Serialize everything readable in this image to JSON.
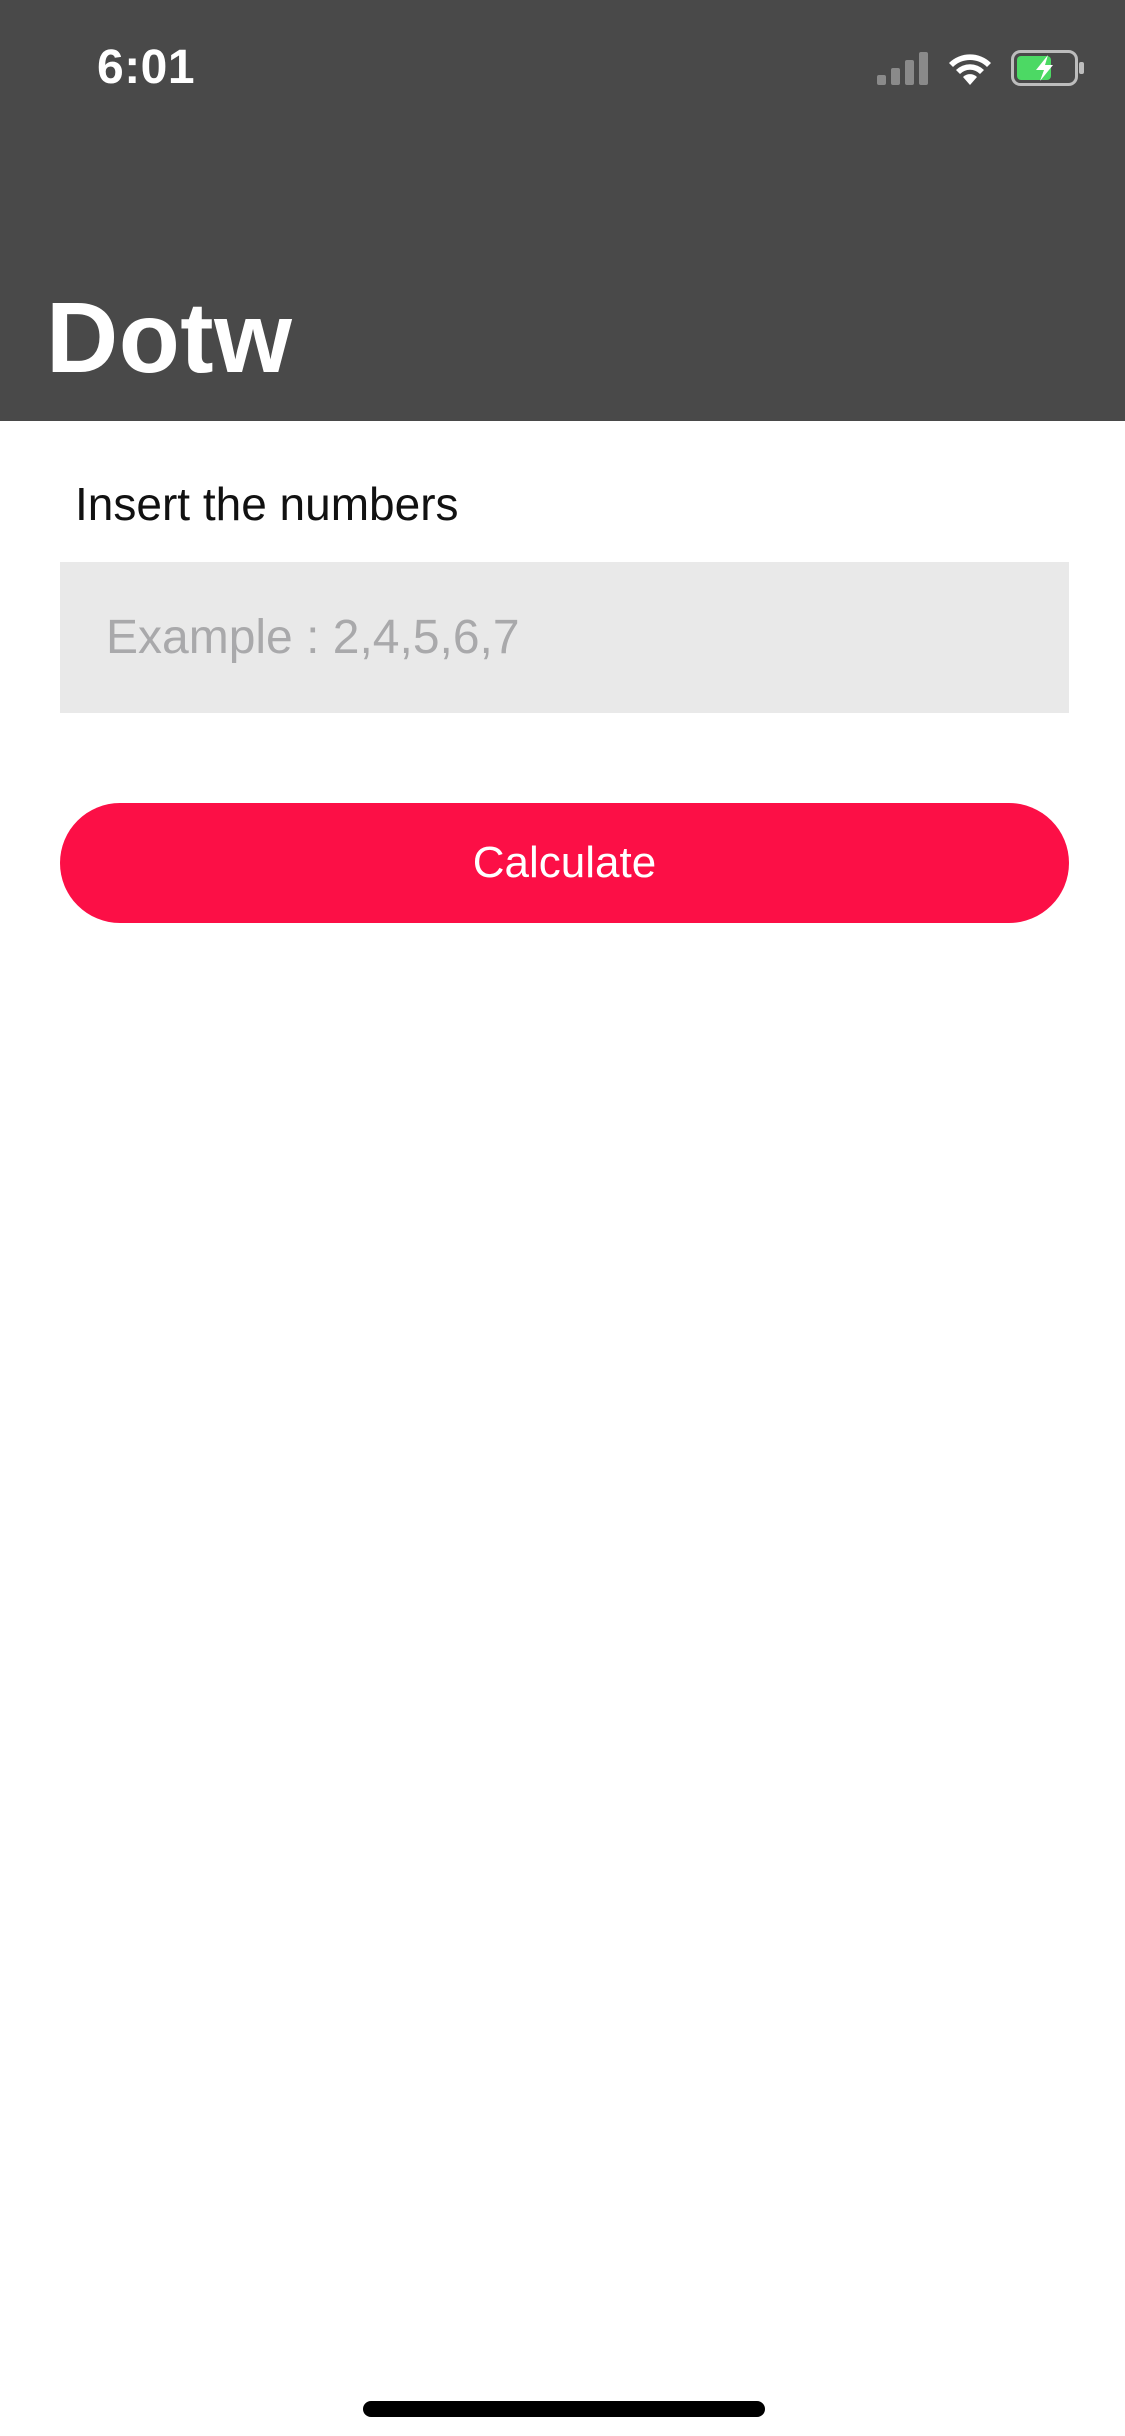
{
  "status_bar": {
    "time": "6:01",
    "icons": [
      "cellular-signal-icon",
      "wifi-icon",
      "battery-charging-icon"
    ]
  },
  "nav": {
    "title": "Dotw"
  },
  "form": {
    "label": "Insert the numbers",
    "input_placeholder": "Example : 2,4,5,6,7",
    "input_value": "",
    "button_label": "Calculate"
  },
  "colors": {
    "header_background": "#494949",
    "accent": "#fc0f46",
    "input_background": "#e9e9e9",
    "battery_fill": "#4cd964"
  }
}
